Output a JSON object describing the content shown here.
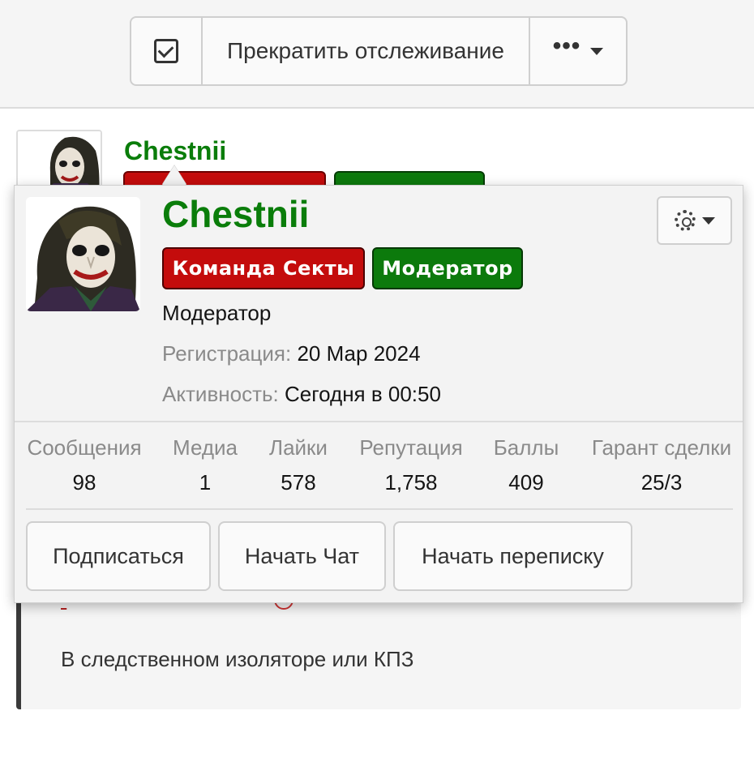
{
  "toolbar": {
    "stop_tracking_label": "Прекратить отслеживание",
    "more_label": "•••"
  },
  "post": {
    "username": "Chestnii",
    "body_text": "В следственном изоляторе или КПЗ"
  },
  "profile_card": {
    "username": "Chestnii",
    "badges": [
      {
        "label": "Команда Секты",
        "color": "#c40c0c"
      },
      {
        "label": "Модератор",
        "color": "#0c7a0c"
      }
    ],
    "user_title": "Модератор",
    "registration_label": "Регистрация:",
    "registration_value": "20 Мар 2024",
    "activity_label": "Активность:",
    "activity_value": "Сегодня в 00:50",
    "stats": [
      {
        "label": "Сообщения",
        "value": "98"
      },
      {
        "label": "Медиа",
        "value": "1"
      },
      {
        "label": "Лайки",
        "value": "578"
      },
      {
        "label": "Репутация",
        "value": "1,758"
      },
      {
        "label": "Баллы",
        "value": "409"
      },
      {
        "label": "Гарант сделки",
        "value": "25/3"
      }
    ],
    "actions": {
      "follow": "Подписаться",
      "start_chat": "Начать Чат",
      "start_conversation": "Начать переписку"
    }
  },
  "colors": {
    "username_green": "#0a7d0a",
    "badge_red": "#c40c0c",
    "badge_green": "#0c7a0c"
  }
}
